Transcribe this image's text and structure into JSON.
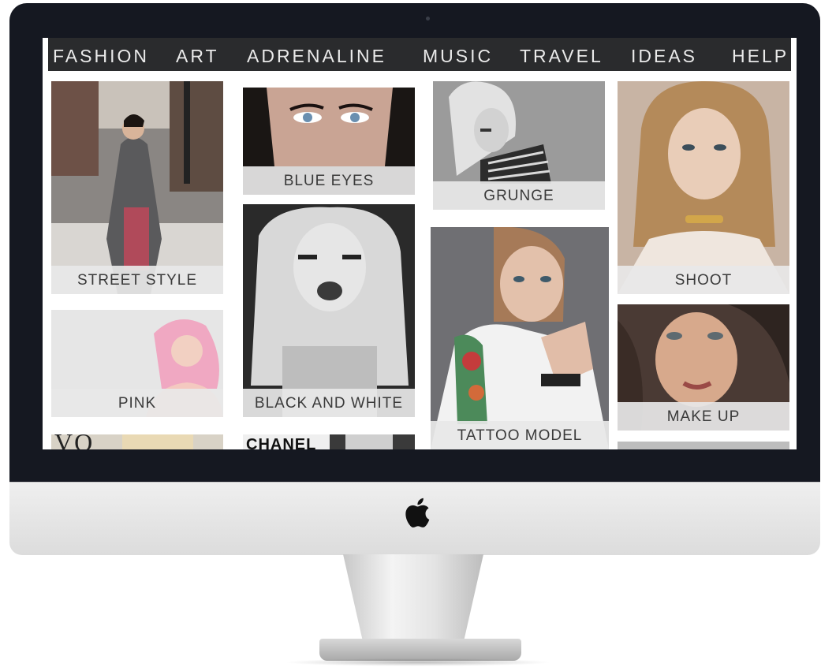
{
  "nav": {
    "items": [
      {
        "label": "FASHION"
      },
      {
        "label": "ART"
      },
      {
        "label": "ADRENALINE"
      },
      {
        "label": "MUSIC"
      },
      {
        "label": "TRAVEL"
      },
      {
        "label": "IDEAS"
      },
      {
        "label": "HELP"
      }
    ]
  },
  "tiles": {
    "street_style": "STREET STYLE",
    "blue_eyes": "BLUE EYES",
    "grunge": "GRUNGE",
    "shoot": "SHOOT",
    "pink": "PINK",
    "black_and_white": "BLACK AND WHITE",
    "tattoo_model": "TATTOO MODEL",
    "make_up": "MAKE UP",
    "chanel_brand": "CHANEL",
    "vogue_brand": "VO"
  },
  "icons": {
    "apple": "apple-logo-icon"
  },
  "colors": {
    "nav_bg": "#2a2b2d",
    "nav_text": "#eaeaea",
    "label_bg": "#e8e8e8",
    "label_text": "#3a3a3a",
    "bezel": "#151821"
  }
}
